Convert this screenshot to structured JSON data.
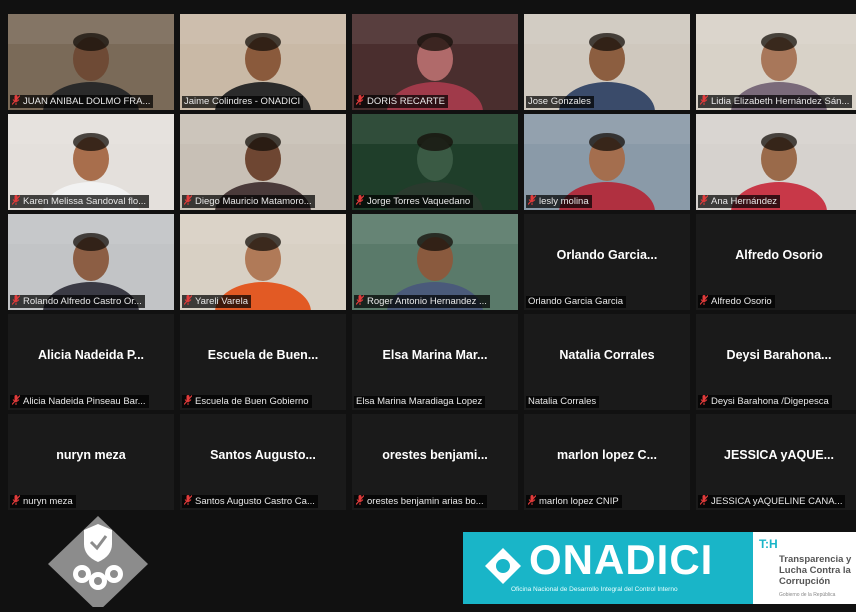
{
  "participants": [
    {
      "label": "JUAN ANIBAL DOLMO FRA...",
      "display_name": "",
      "video": true,
      "muted": true,
      "active": false,
      "bg": "#7a6a58",
      "skin": "#6e4a35",
      "shirt": "#2a2a2a"
    },
    {
      "label": "Jaime Colindres - ONADICI",
      "display_name": "",
      "video": true,
      "muted": false,
      "active": true,
      "bg": "#c9b9a6",
      "skin": "#8a5a3c",
      "shirt": "#2b2b2b"
    },
    {
      "label": "DORIS RECARTE",
      "display_name": "",
      "video": true,
      "muted": true,
      "active": false,
      "bg": "#4a2e2e",
      "skin": "#b06a6a",
      "shirt": "#a03a4a"
    },
    {
      "label": "Jose Gonzales",
      "display_name": "",
      "video": true,
      "muted": false,
      "active": false,
      "bg": "#cfc8be",
      "skin": "#8c5e40",
      "shirt": "#3a4b6a"
    },
    {
      "label": "Lidia Elizabeth Hernández Sán...",
      "display_name": "",
      "video": true,
      "muted": true,
      "active": false,
      "bg": "#d8d2c8",
      "skin": "#a8775a",
      "shirt": "#7a6a7a"
    },
    {
      "label": "Karen Melissa Sandoval flo...",
      "display_name": "",
      "video": true,
      "muted": true,
      "active": false,
      "bg": "#e4e0dc",
      "skin": "#a86e4c",
      "shirt": "#f2f2f2"
    },
    {
      "label": "Diego Mauricio Matamoro...",
      "display_name": "",
      "video": true,
      "muted": true,
      "active": false,
      "bg": "#c8c0b6",
      "skin": "#6e4632",
      "shirt": "#4a3a3a"
    },
    {
      "label": "Jorge Torres Vaquedano",
      "display_name": "",
      "video": true,
      "muted": true,
      "active": false,
      "bg": "#1f3e2a",
      "skin": "#3a5a44",
      "shirt": "#2a3a2e"
    },
    {
      "label": "lesly molina",
      "display_name": "",
      "video": true,
      "muted": true,
      "active": false,
      "bg": "#8a9aa8",
      "skin": "#a46e4e",
      "shirt": "#b03040"
    },
    {
      "label": "Ana Hernández",
      "display_name": "",
      "video": true,
      "muted": true,
      "active": false,
      "bg": "#d6d2ce",
      "skin": "#9a6a4a",
      "shirt": "#c83848"
    },
    {
      "label": "Rolando Alfredo Castro Or...",
      "display_name": "",
      "video": true,
      "muted": true,
      "active": false,
      "bg": "#c2c4c6",
      "skin": "#8c5e44",
      "shirt": "#3a3a44"
    },
    {
      "label": "Yareli Varela",
      "display_name": "",
      "video": true,
      "muted": true,
      "active": false,
      "bg": "#d8d0c4",
      "skin": "#b07a58",
      "shirt": "#e25a24"
    },
    {
      "label": "Roger Antonio Hernandez ...",
      "display_name": "",
      "video": true,
      "muted": true,
      "active": false,
      "bg": "#5a7a6a",
      "skin": "#8a5a3e",
      "shirt": "#4a5a7a"
    },
    {
      "label": "Orlando Garcia Garcia",
      "display_name": "Orlando Garcia...",
      "video": false,
      "muted": false,
      "active": false
    },
    {
      "label": "Alfredo Osorio",
      "display_name": "Alfredo Osorio",
      "video": false,
      "muted": true,
      "active": false
    },
    {
      "label": "Alicia Nadeida Pinseau Bar...",
      "display_name": "Alicia Nadeida P...",
      "video": false,
      "muted": true,
      "active": false
    },
    {
      "label": "Escuela de Buen Gobierno",
      "display_name": "Escuela de Buen...",
      "video": false,
      "muted": true,
      "active": false
    },
    {
      "label": "Elsa Marina Maradiaga Lopez",
      "display_name": "Elsa Marina Mar...",
      "video": false,
      "muted": false,
      "active": false
    },
    {
      "label": "Natalia Corrales",
      "display_name": "Natalia Corrales",
      "video": false,
      "muted": false,
      "active": false
    },
    {
      "label": "Deysi Barahona /Digepesca",
      "display_name": "Deysi Barahona...",
      "video": false,
      "muted": true,
      "active": false
    },
    {
      "label": "nuryn meza",
      "display_name": "nuryn meza",
      "video": false,
      "muted": true,
      "active": false
    },
    {
      "label": "Santos Augusto Castro Ca...",
      "display_name": "Santos Augusto...",
      "video": false,
      "muted": true,
      "active": false
    },
    {
      "label": "orestes benjamin arias bo...",
      "display_name": "orestes benjami...",
      "video": false,
      "muted": true,
      "active": false
    },
    {
      "label": "marlon lopez CNIP",
      "display_name": "marlon lopez C...",
      "video": false,
      "muted": true,
      "active": false
    },
    {
      "label": "JESSICA yAQUELINE CANA...",
      "display_name": "JESSICA yAQUE...",
      "video": false,
      "muted": true,
      "active": false
    }
  ],
  "footer": {
    "badge_icon": "shield-gears-icon",
    "onadici_word": "ONADICI",
    "onadici_subtitle": "Oficina Nacional de Desarrollo Integral del Control Interno",
    "th_mark": "T:H",
    "th_text": "Transparencia y Lucha Contra la Corrupción",
    "th_small": "Gobierno de la República",
    "banner_color": "#19b5c8"
  }
}
